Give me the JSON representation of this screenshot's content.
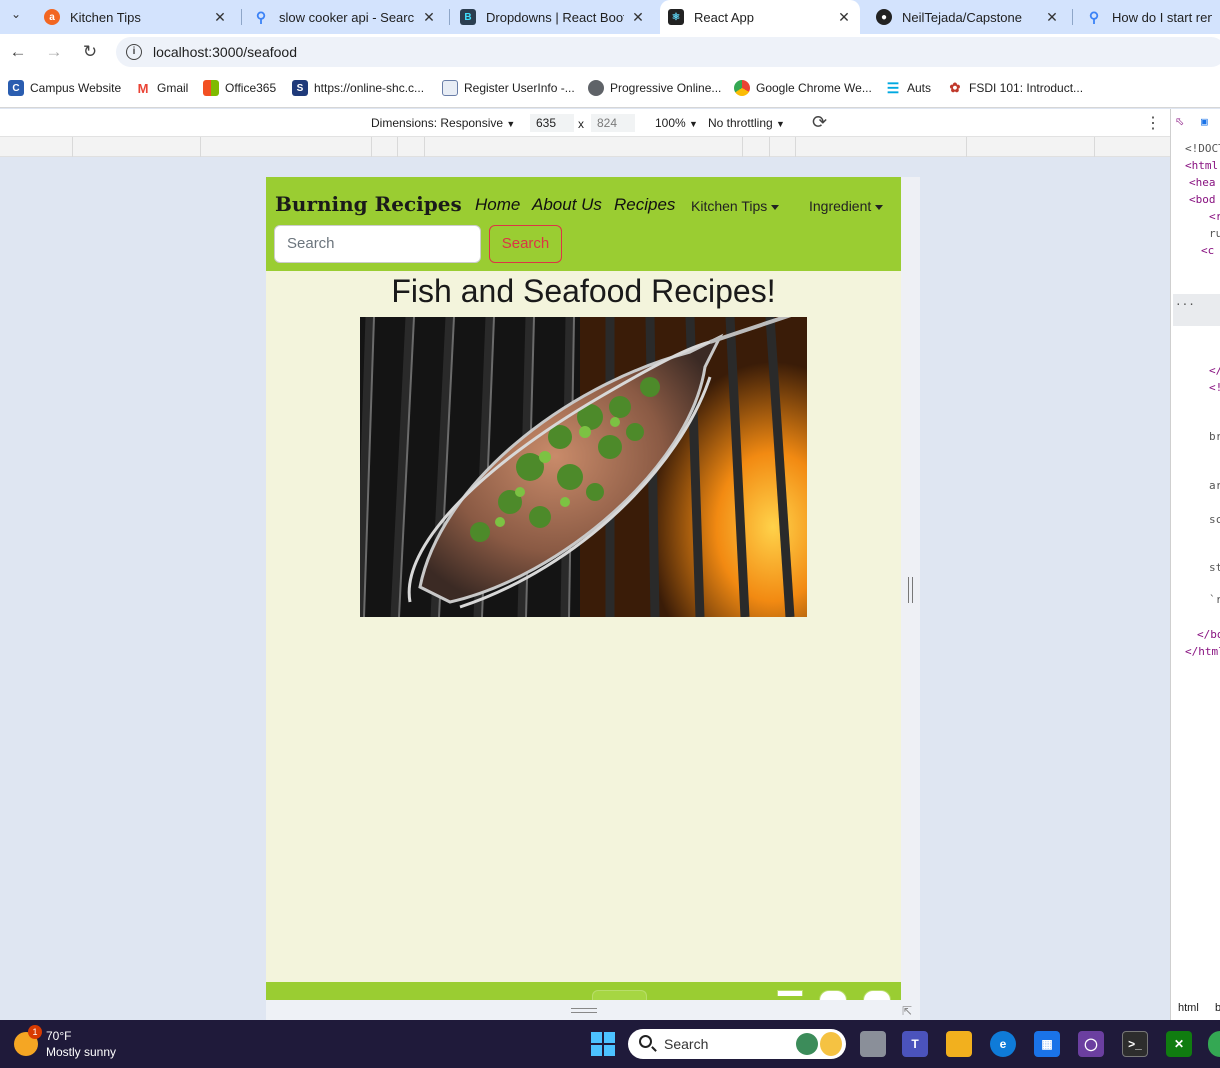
{
  "browser": {
    "tabs": [
      {
        "title": "Kitchen Tips",
        "icon": "allrecipes-icon",
        "color": "#f26622"
      },
      {
        "title": "slow cooker api - Search",
        "icon": "bing-search-icon",
        "color": "#3b82f6"
      },
      {
        "title": "Dropdowns | React Bootst",
        "icon": "react-bootstrap-icon",
        "color": "#41e0fd"
      },
      {
        "title": "React App",
        "icon": "react-icon",
        "color": "#222222"
      },
      {
        "title": "NeilTejada/Capstone",
        "icon": "github-icon",
        "color": "#222222"
      },
      {
        "title": "How do I start render",
        "icon": "bing-search-icon",
        "color": "#3b82f6"
      }
    ],
    "url": "localhost:3000/seafood",
    "bookmarks": [
      {
        "label": "Campus Website",
        "icon": "campus-icon",
        "color": "#2a5db0"
      },
      {
        "label": "Gmail",
        "icon": "gmail-icon",
        "color": "#ea4335"
      },
      {
        "label": "Office365",
        "icon": "office-icon",
        "color": "#f25022"
      },
      {
        "label": "https://online-shc.c...",
        "icon": "shc-icon",
        "color": "#1f3a7a"
      },
      {
        "label": "Register UserInfo -...",
        "icon": "document-icon",
        "color": "#6a7ea8"
      },
      {
        "label": "Progressive Online...",
        "icon": "globe-icon",
        "color": "#5f6368"
      },
      {
        "label": "Google Chrome We...",
        "icon": "chrome-icon",
        "color": "#34a853"
      },
      {
        "label": "Auts",
        "icon": "auts-icon",
        "color": "#00a8e0"
      },
      {
        "label": "FSDI 101: Introduct...",
        "icon": "fsdi-icon",
        "color": "#c0392b"
      }
    ]
  },
  "devtools": {
    "dimensions_label": "Dimensions: Responsive",
    "width_value": "635",
    "times": "x",
    "height_placeholder": "824",
    "zoom": "100%",
    "throttling": "No throttling",
    "elements_lines": [
      "<!DOCT",
      "<html",
      "<hea",
      "<bod",
      "<r",
      "ru",
      "<c",
      "",
      "...",
      "</",
      "<!",
      "br",
      "ar",
      "sc",
      "st",
      "`r",
      "</bo",
      "</html"
    ],
    "bottom_tab": "html",
    "bottom_tab2": "b"
  },
  "site": {
    "brand": "Burning Recipes",
    "nav_links": [
      "Home",
      "About Us",
      "Recipes"
    ],
    "dropdowns": [
      "Kitchen Tips",
      "Ingredient"
    ],
    "search_placeholder": "Search",
    "search_button": "Search",
    "heading": "Fish and Seafood Recipes!",
    "colors": {
      "navbar": "#9acd32",
      "background": "#f3f4dc",
      "search_accent": "#dc3545"
    }
  },
  "taskbar": {
    "temperature": "70°F",
    "condition": "Mostly sunny",
    "badge": "1",
    "search_label": "Search"
  }
}
